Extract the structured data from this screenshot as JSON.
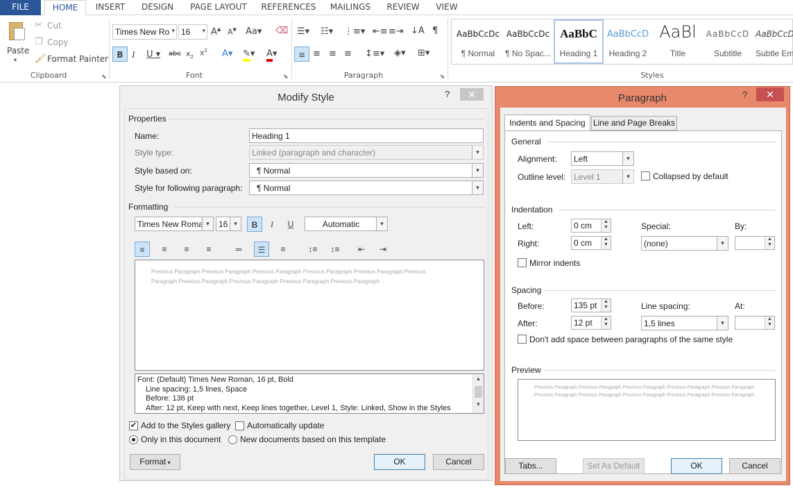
{
  "ribbon_tabs": [
    "FILE",
    "HOME",
    "INSERT",
    "DESIGN",
    "PAGE LAYOUT",
    "REFERENCES",
    "MAILINGS",
    "REVIEW",
    "VIEW"
  ],
  "clipboard": {
    "paste": "Paste",
    "cut": "Cut",
    "copy": "Copy",
    "format_painter": "Format Painter",
    "label": "Clipboard"
  },
  "font": {
    "name": "Times New Ro",
    "size": "16",
    "label": "Font"
  },
  "paragraph_group": {
    "label": "Paragraph"
  },
  "styles": {
    "label": "Styles",
    "items": [
      {
        "preview": "AaBbCcDc",
        "name": "¶ Normal"
      },
      {
        "preview": "AaBbCcDc",
        "name": "¶ No Spac..."
      },
      {
        "preview": "AaBbC",
        "name": "Heading 1"
      },
      {
        "preview": "AaBbCcD",
        "name": "Heading 2"
      },
      {
        "preview": "AaBl",
        "name": "Title"
      },
      {
        "preview": "AaBbCcD",
        "name": "Subtitle"
      },
      {
        "preview": "AaBbCcDc",
        "name": "Subtle Em"
      }
    ]
  },
  "modify_style": {
    "title": "Modify Style",
    "properties": "Properties",
    "name_label": "Name:",
    "name_value": "Heading 1",
    "style_type_label": "Style type:",
    "style_type_value": "Linked (paragraph and character)",
    "based_on_label": "Style based on:",
    "based_on_value": "¶ Normal",
    "following_label": "Style for following paragraph:",
    "following_value": "¶ Normal",
    "formatting": "Formatting",
    "font_name": "Times New Roman",
    "font_size": "16",
    "color": "Automatic",
    "preview_line1": "Previous Paragraph Previous Paragraph Previous Paragraph Previous Paragraph Previous Paragraph Previous",
    "preview_line2": "Paragraph Previous Paragraph Previous Paragraph Previous Paragraph Previous Paragraph",
    "desc_line1": "Font: (Default) Times New Roman, 16 pt, Bold",
    "desc_line2": "Line spacing:  1,5 lines, Space",
    "desc_line3": "Before:  136 pt",
    "desc_line4": "After:  12 pt, Keep with next, Keep lines together, Level 1, Style: Linked, Show in the Styles",
    "add_gallery": "Add to the Styles gallery",
    "auto_update": "Automatically update",
    "only_doc": "Only in this document",
    "new_docs": "New documents based on this template",
    "format_btn": "Format",
    "ok": "OK",
    "cancel": "Cancel"
  },
  "paragraph_dialog": {
    "title": "Paragraph",
    "tab1": "Indents and Spacing",
    "tab2": "Line and Page Breaks",
    "general": "General",
    "alignment_label": "Alignment:",
    "alignment_value": "Left",
    "outline_label": "Outline level:",
    "outline_value": "Level 1",
    "collapsed": "Collapsed by default",
    "indentation": "Indentation",
    "left_label": "Left:",
    "left_value": "0 cm",
    "right_label": "Right:",
    "right_value": "0 cm",
    "special_label": "Special:",
    "special_value": "(none)",
    "by_label": "By:",
    "mirror": "Mirror indents",
    "spacing": "Spacing",
    "before_label": "Before:",
    "before_value": "135 pt",
    "after_label": "After:",
    "after_value": "12 pt",
    "line_spacing_label": "Line spacing:",
    "line_spacing_value": "1,5 lines",
    "at_label": "At:",
    "dont_add": "Don't add space between paragraphs of the same style",
    "preview": "Preview",
    "preview_line1": "Previous Paragraph Previous Paragraph Previous Paragraph Previous Paragraph Previous Paragraph",
    "preview_line2": "Previous Paragraph Previous Paragraph Previous Paragraph Previous Paragraph Previous Paragraph",
    "tabs_btn": "Tabs...",
    "set_default": "Set As Default",
    "ok": "OK",
    "cancel": "Cancel"
  },
  "colors": {
    "file_tab": "#2b579a",
    "para_frame": "#e8896b"
  }
}
